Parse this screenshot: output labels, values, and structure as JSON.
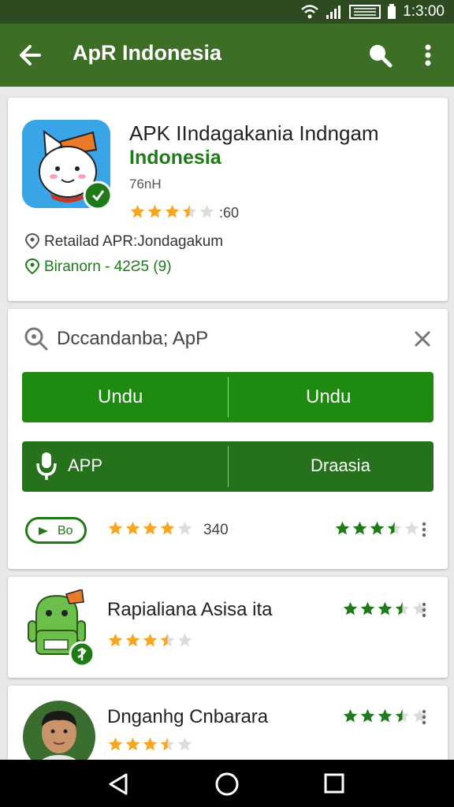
{
  "status": {
    "time": "1:3:00"
  },
  "appbar": {
    "title": "ApR Indonesia"
  },
  "app": {
    "title": "APK IIndagakania Indngam",
    "subtitle": "Indonesia",
    "size": "76nH",
    "rating_text": ":60",
    "rating": 3.5,
    "retail_text": "Retailad APR:Jondagakum",
    "location_text": "Biranorn - 42Ƨ5 (9)"
  },
  "search": {
    "text": "Dccandanba; ApP"
  },
  "buttons": {
    "download_left": "Undu",
    "download_right": "Undu",
    "app_label": "APP",
    "right_label": "Draasia"
  },
  "rating_row": {
    "badge": "Bo",
    "count": "340",
    "left_rating": 4,
    "right_rating": 3.5
  },
  "list": [
    {
      "name": "Rapialiana Asisa ita",
      "rating": 3.5,
      "right_rating": 3.5
    },
    {
      "name": "Dnganhg Cnbarara",
      "rating": 3.5,
      "right_rating": 3.5
    }
  ],
  "colors": {
    "appbar": "#3c6e25",
    "statusbar": "#2e4a21",
    "button": "#1f8a10",
    "accent_green": "#1f7a18",
    "star": "#f5a623"
  }
}
